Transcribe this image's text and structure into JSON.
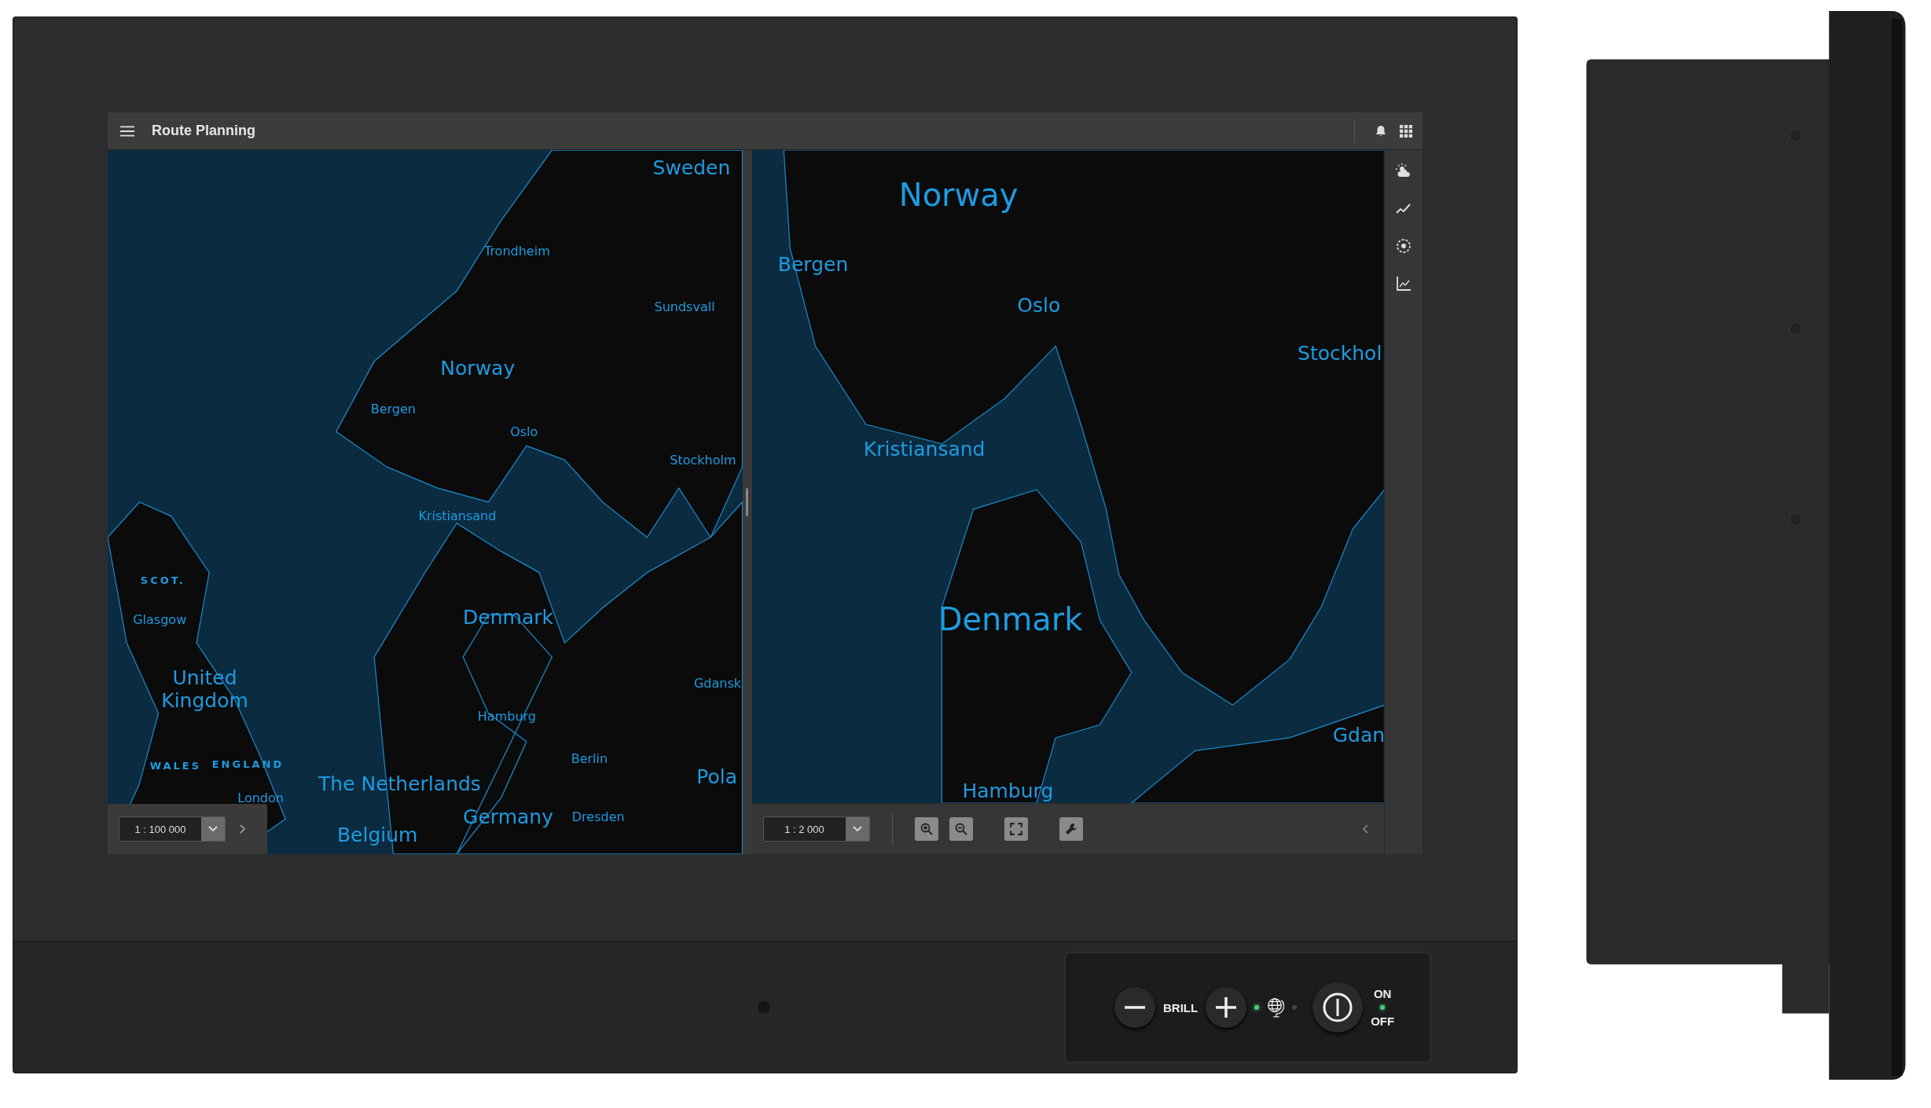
{
  "app": {
    "title": "Route Planning"
  },
  "maps": [
    {
      "scale": "1 : 100 000",
      "labels": [
        {
          "text": "Sweden",
          "kind": "country"
        },
        {
          "text": "Trondheim",
          "kind": "city"
        },
        {
          "text": "Sundsvall",
          "kind": "city"
        },
        {
          "text": "Norway",
          "kind": "country"
        },
        {
          "text": "Bergen",
          "kind": "city"
        },
        {
          "text": "Oslo",
          "kind": "city"
        },
        {
          "text": "Stockholm",
          "kind": "city"
        },
        {
          "text": "Kristiansand",
          "kind": "city"
        },
        {
          "text": "SCOT.",
          "kind": "region"
        },
        {
          "text": "Glasgow",
          "kind": "city"
        },
        {
          "text": "Denmark",
          "kind": "country"
        },
        {
          "text": "United Kingdom",
          "kind": "country"
        },
        {
          "text": "Gdansk",
          "kind": "city"
        },
        {
          "text": "Hamburg",
          "kind": "city"
        },
        {
          "text": "Berlin",
          "kind": "city"
        },
        {
          "text": "Pola",
          "kind": "country"
        },
        {
          "text": "WALES",
          "kind": "region"
        },
        {
          "text": "ENGLAND",
          "kind": "region"
        },
        {
          "text": "London",
          "kind": "city"
        },
        {
          "text": "The Netherlands",
          "kind": "country"
        },
        {
          "text": "Germany",
          "kind": "country"
        },
        {
          "text": "Dresden",
          "kind": "city"
        },
        {
          "text": "Belgium",
          "kind": "country"
        }
      ]
    },
    {
      "scale": "1 : 2 000",
      "labels": [
        {
          "text": "Norway",
          "kind": "country"
        },
        {
          "text": "Bergen",
          "kind": "city"
        },
        {
          "text": "Oslo",
          "kind": "city"
        },
        {
          "text": "Stockhol",
          "kind": "city"
        },
        {
          "text": "Kristiansand",
          "kind": "city"
        },
        {
          "text": "Denmark",
          "kind": "country"
        },
        {
          "text": "Gdan",
          "kind": "city"
        },
        {
          "text": "Hamburg",
          "kind": "city"
        }
      ]
    }
  ],
  "panel": {
    "brightness_label": "BRILL",
    "power_on": "ON",
    "power_off": "OFF"
  }
}
